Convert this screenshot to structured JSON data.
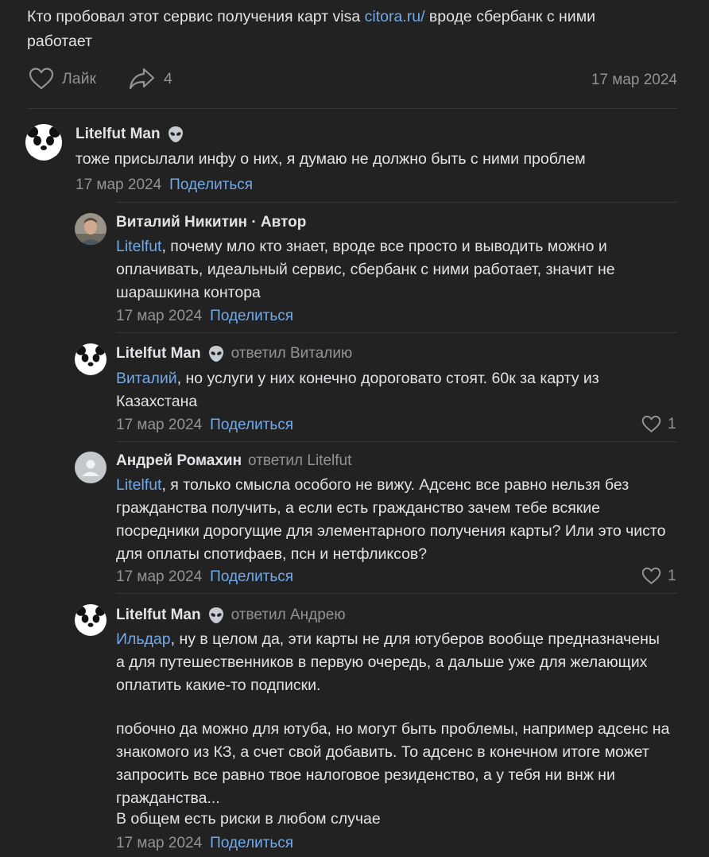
{
  "post": {
    "text_before": "Кто пробовал этот сервис получения карт visa ",
    "link": "citora.ru/",
    "text_after": " вроде сбербанк с ними работает",
    "like_label": "Лайк",
    "share_count": "4",
    "date": "17 мар 2024"
  },
  "share_label": "Поделиться",
  "comments": [
    {
      "author": "Litelfut Man",
      "text": "тоже присылали инфу о них, я думаю не должно быть с ними проблем",
      "date": "17 мар 2024"
    },
    {
      "author": "Виталий Никитин · Автор",
      "mention": "Litelfut",
      "text": ", почему мло кто знает, вроде все просто и выводить можно и оплачивать, идеальный сервис, сбербанк с ними работает, значит не шарашкина контора",
      "date": "17 мар 2024"
    },
    {
      "author": "Litelfut Man",
      "reply_to": "ответил Виталию",
      "mention": "Виталий",
      "text": ", но услуги у них конечно дороговато стоят. 60к за карту из Казахстана",
      "date": "17 мар 2024",
      "likes": "1"
    },
    {
      "author": "Андрей Ромахин",
      "reply_to": "ответил Litelfut",
      "mention": "Litelfut",
      "text": ", я только смысла особого не вижу. Адсенс все равно нельзя без гражданства получить, а если есть гражданство зачем тебе всякие посредники дорогущие для элементарного получения карты? Или это чисто для оплаты спотифаев, псн и нетфликсов?",
      "date": "17 мар 2024",
      "likes": "1"
    },
    {
      "author": "Litelfut Man",
      "reply_to": "ответил Андрею",
      "mention": "Ильдар",
      "text": ", ну в целом да, эти карты не для ютуберов вообще предназначены а для путешественников в первую очередь, а дальше уже для желающих оплатить какие-то подписки.",
      "text2": "побочно да можно для ютуба, но могут быть проблемы, например адсенс на знакомого из КЗ, а счет свой добавить. То адсенс в конечном итоге может запросить все равно твое налоговое резиденство, а у тебя ни внж ни гражданства...",
      "text3": "В общем есть риски в любом случае",
      "date": "17 мар 2024"
    }
  ],
  "colors": {
    "background": "#222222",
    "text": "#e1e3e6",
    "muted": "#939393",
    "link": "#71aaeb",
    "separator": "#363738"
  },
  "icons": {
    "like": "heart-icon",
    "share": "share-arrow-icon",
    "badge": "alien-emoji-icon",
    "avatar_placeholder": "user-silhouette-icon"
  }
}
